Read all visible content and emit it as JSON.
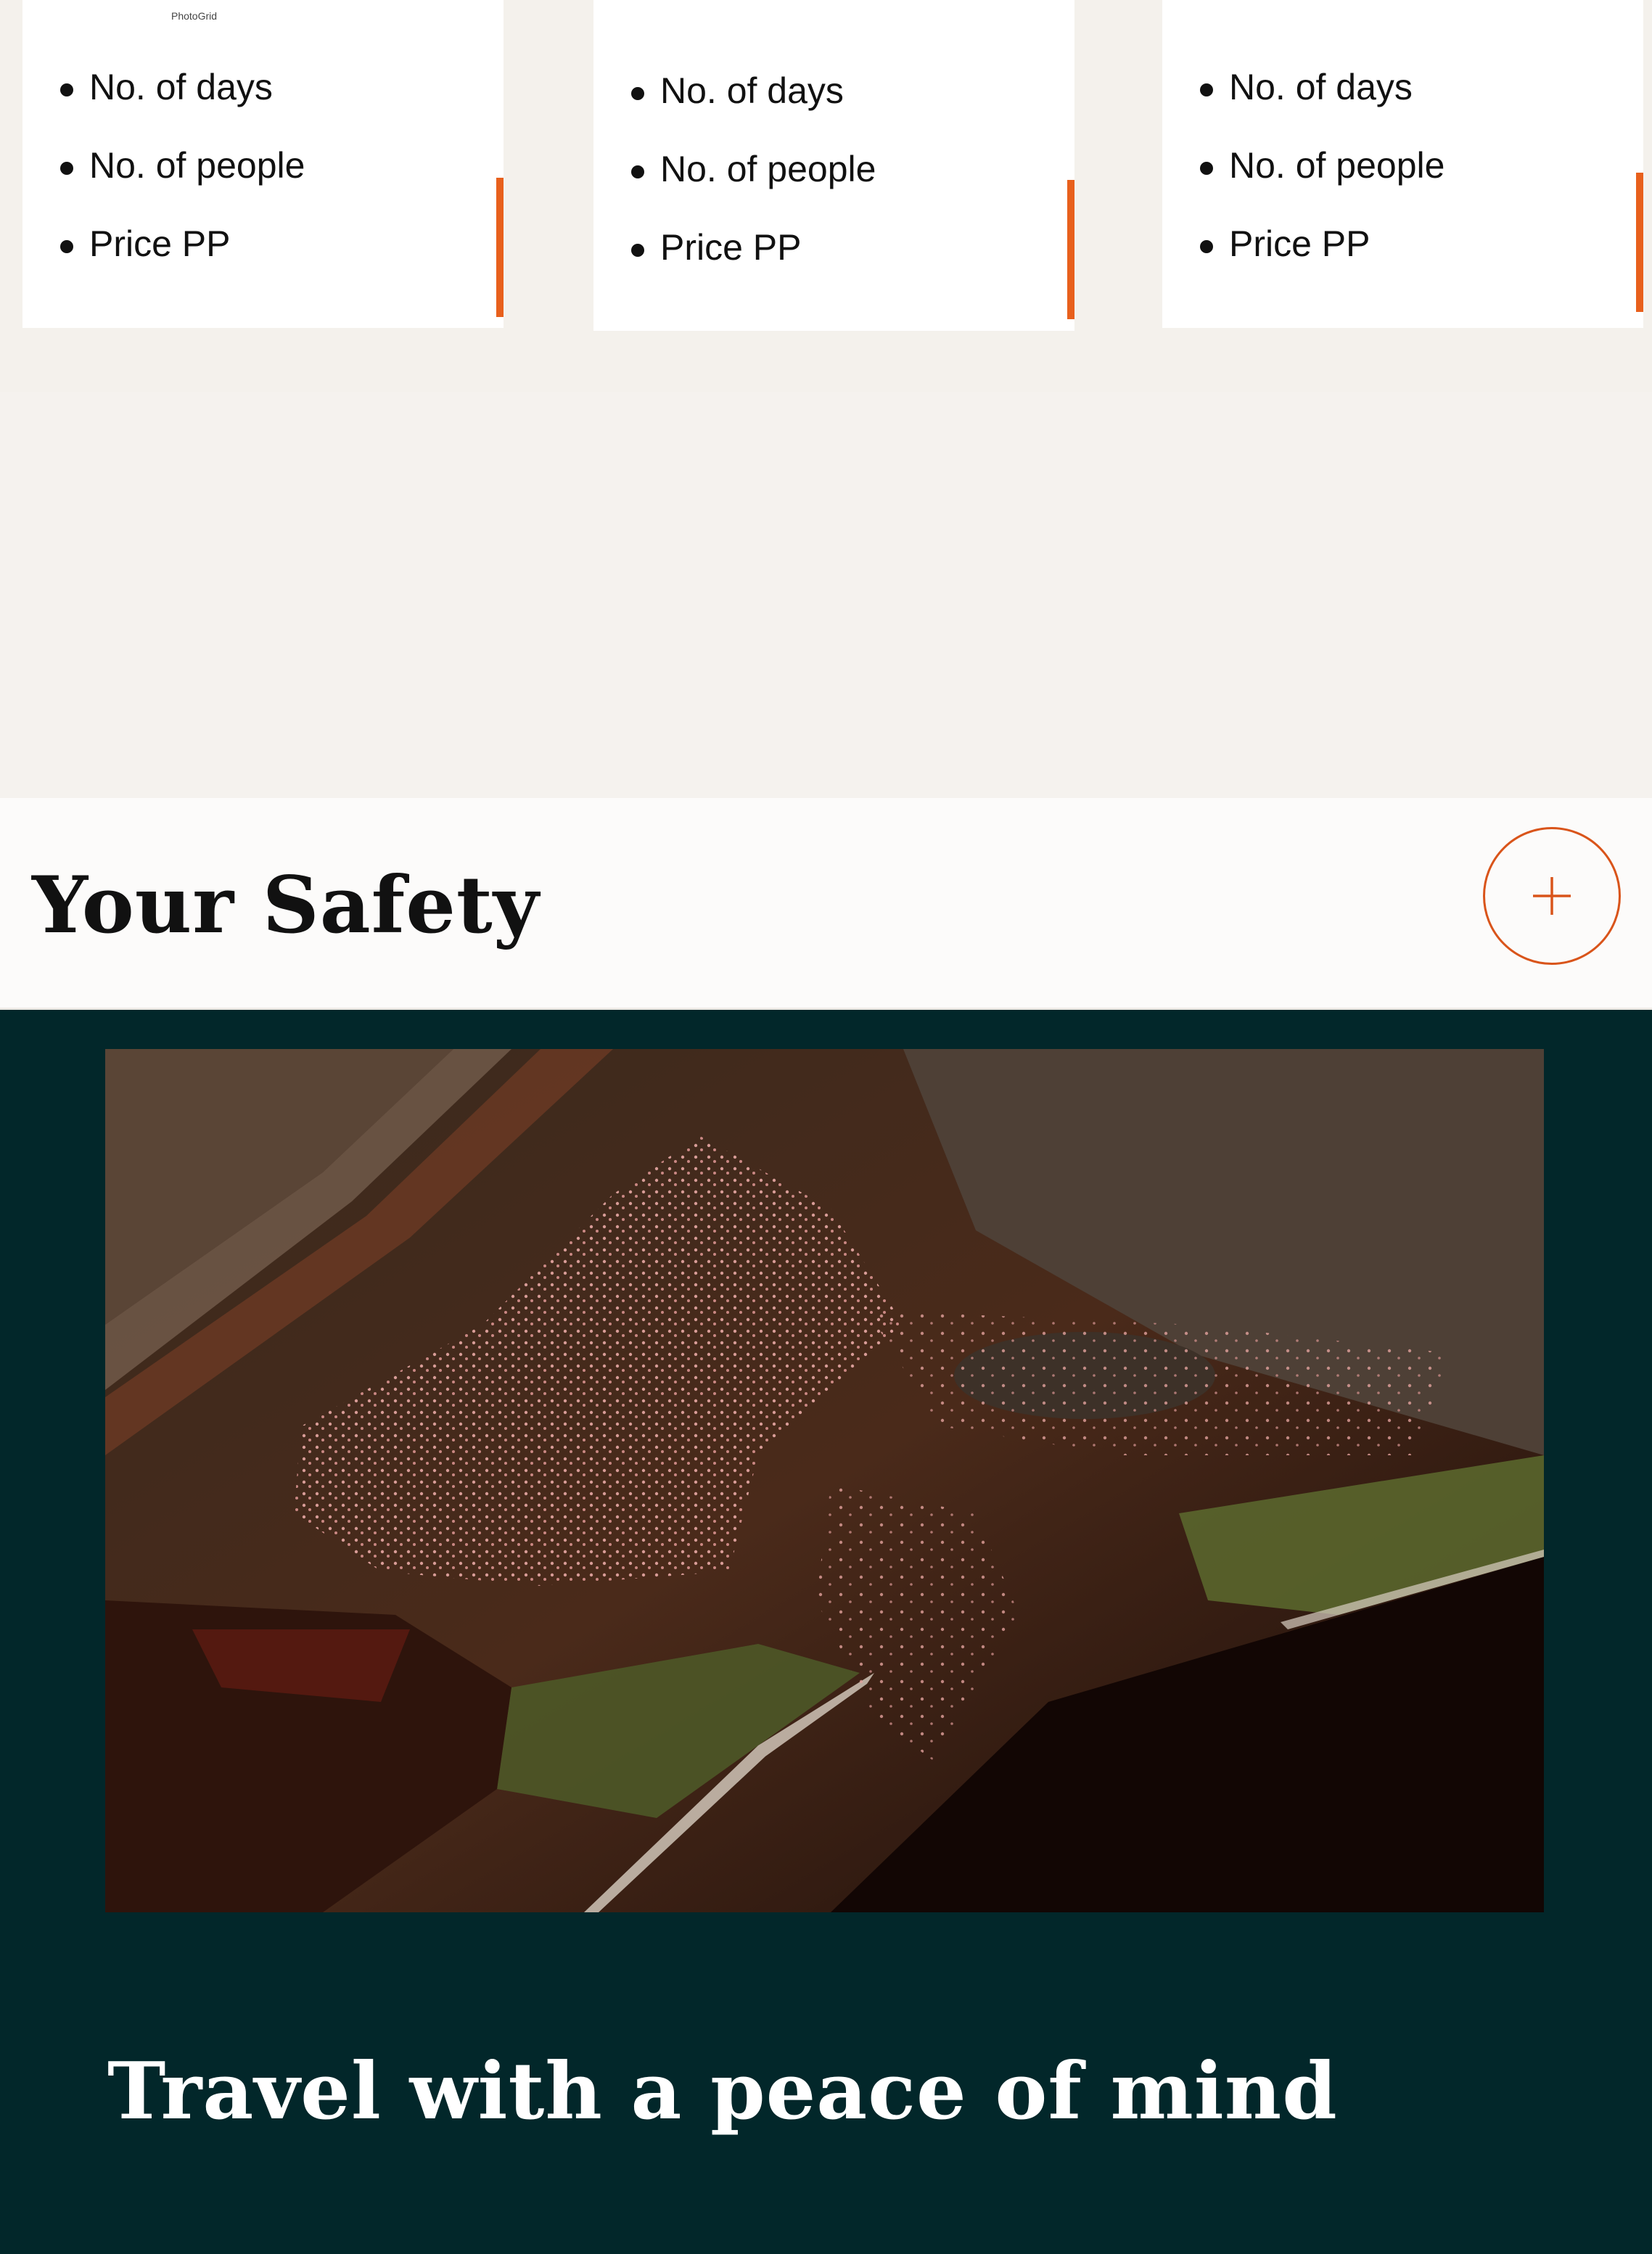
{
  "cards": [
    {
      "items": [
        "No. of days",
        "No. of people",
        "Price PP"
      ],
      "watermark": "PhotoGrid"
    },
    {
      "items": [
        "No. of days",
        "No. of people",
        "Price PP"
      ]
    },
    {
      "items": [
        "No. of days",
        "No. of people",
        "Price PP"
      ]
    }
  ],
  "accordion": {
    "title": "Your Safety",
    "toggle_icon": "plus-icon"
  },
  "feature": {
    "image_alt": "Aerial view of flamingos on a lakeshore",
    "tagline": "Travel with a peace of mind"
  },
  "colors": {
    "accent": "#e8601c",
    "dark_bg": "#02272a",
    "light_bg": "#f5f2ee"
  }
}
